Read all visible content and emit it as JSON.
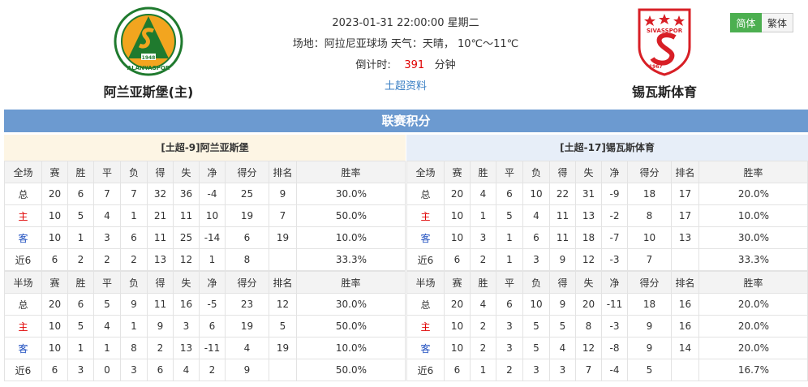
{
  "header": {
    "datetime": "2023-01-31 22:00:00 星期二",
    "venue_line": "场地：阿拉尼亚球场 天气：天晴， 10℃～11℃",
    "countdown_label": "倒计时:",
    "countdown_value": "391",
    "countdown_unit": "分钟",
    "league_link": "土超资料",
    "home_team": "阿兰亚斯堡(主)",
    "away_team": "锡瓦斯体育",
    "home_logo_text": "ALANYASPOR",
    "home_logo_year": "1948",
    "away_logo_text": "SIVASSPOR",
    "away_logo_year": "1967"
  },
  "lang": {
    "simplified": "简体",
    "traditional": "繁体"
  },
  "section_title": "联赛积分",
  "colors": {
    "band": "#6c9ad0",
    "accent_green": "#4caf50",
    "countdown_red": "#e00000"
  },
  "home": {
    "title": "[土超-9]阿兰亚斯堡",
    "full": {
      "header": [
        "全场",
        "赛",
        "胜",
        "平",
        "负",
        "得",
        "失",
        "净",
        "得分",
        "排名",
        "胜率"
      ],
      "rows": [
        [
          "总",
          "20",
          "6",
          "7",
          "7",
          "32",
          "36",
          "-4",
          "25",
          "9",
          "30.0%"
        ],
        [
          "主",
          "10",
          "5",
          "4",
          "1",
          "21",
          "11",
          "10",
          "19",
          "7",
          "50.0%"
        ],
        [
          "客",
          "10",
          "1",
          "3",
          "6",
          "11",
          "25",
          "-14",
          "6",
          "19",
          "10.0%"
        ],
        [
          "近6",
          "6",
          "2",
          "2",
          "2",
          "13",
          "12",
          "1",
          "8",
          "",
          "33.3%"
        ]
      ]
    },
    "half": {
      "header": [
        "半场",
        "赛",
        "胜",
        "平",
        "负",
        "得",
        "失",
        "净",
        "得分",
        "排名",
        "胜率"
      ],
      "rows": [
        [
          "总",
          "20",
          "6",
          "5",
          "9",
          "11",
          "16",
          "-5",
          "23",
          "12",
          "30.0%"
        ],
        [
          "主",
          "10",
          "5",
          "4",
          "1",
          "9",
          "3",
          "6",
          "19",
          "5",
          "50.0%"
        ],
        [
          "客",
          "10",
          "1",
          "1",
          "8",
          "2",
          "13",
          "-11",
          "4",
          "19",
          "10.0%"
        ],
        [
          "近6",
          "6",
          "3",
          "0",
          "3",
          "6",
          "4",
          "2",
          "9",
          "",
          "50.0%"
        ]
      ]
    }
  },
  "away": {
    "title": "[土超-17]锡瓦斯体育",
    "full": {
      "header": [
        "全场",
        "赛",
        "胜",
        "平",
        "负",
        "得",
        "失",
        "净",
        "得分",
        "排名",
        "胜率"
      ],
      "rows": [
        [
          "总",
          "20",
          "4",
          "6",
          "10",
          "22",
          "31",
          "-9",
          "18",
          "17",
          "20.0%"
        ],
        [
          "主",
          "10",
          "1",
          "5",
          "4",
          "11",
          "13",
          "-2",
          "8",
          "17",
          "10.0%"
        ],
        [
          "客",
          "10",
          "3",
          "1",
          "6",
          "11",
          "18",
          "-7",
          "10",
          "13",
          "30.0%"
        ],
        [
          "近6",
          "6",
          "2",
          "1",
          "3",
          "9",
          "12",
          "-3",
          "7",
          "",
          "33.3%"
        ]
      ]
    },
    "half": {
      "header": [
        "半场",
        "赛",
        "胜",
        "平",
        "负",
        "得",
        "失",
        "净",
        "得分",
        "排名",
        "胜率"
      ],
      "rows": [
        [
          "总",
          "20",
          "4",
          "6",
          "10",
          "9",
          "20",
          "-11",
          "18",
          "16",
          "20.0%"
        ],
        [
          "主",
          "10",
          "2",
          "3",
          "5",
          "5",
          "8",
          "-3",
          "9",
          "16",
          "20.0%"
        ],
        [
          "客",
          "10",
          "2",
          "3",
          "5",
          "4",
          "12",
          "-8",
          "9",
          "14",
          "20.0%"
        ],
        [
          "近6",
          "6",
          "1",
          "2",
          "3",
          "3",
          "7",
          "-4",
          "5",
          "",
          "16.7%"
        ]
      ]
    }
  }
}
